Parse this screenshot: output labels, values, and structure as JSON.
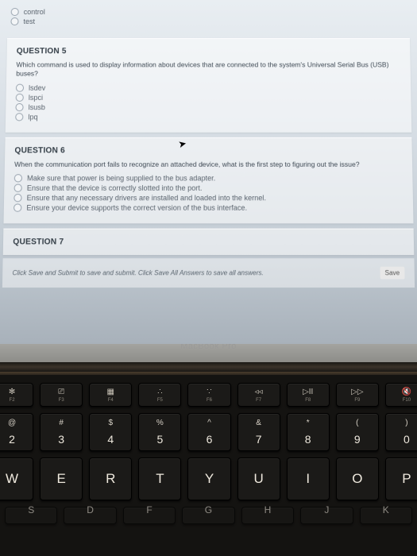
{
  "topOptions": [
    "control",
    "test"
  ],
  "q5": {
    "title": "QUESTION 5",
    "prompt": "Which command is used to display information about devices that are connected to the system's Universal Serial Bus (USB) buses?",
    "options": [
      "lsdev",
      "lspci",
      "lsusb",
      "lpq"
    ]
  },
  "q6": {
    "title": "QUESTION 6",
    "prompt": "When the communication port fails to recognize an attached device, what is the first step to figuring out the issue?",
    "options": [
      "Make sure that power is being supplied to the bus adapter.",
      "Ensure that the device is correctly slotted into the port.",
      "Ensure that any necessary drivers are installed and loaded into the kernel.",
      "Ensure your device supports the correct version of the bus interface."
    ]
  },
  "q7": {
    "title": "QUESTION 7"
  },
  "footer": {
    "text": "Click Save and Submit to save and submit. Click Save All Answers to save all answers.",
    "button": "Save"
  },
  "bezel": "MacBook Pro",
  "keyboard": {
    "frow": [
      {
        "glyph": "✻",
        "label": "F2"
      },
      {
        "glyph": "⎚",
        "label": "F3"
      },
      {
        "glyph": "▦",
        "label": "F4"
      },
      {
        "glyph": "∴",
        "label": "F5"
      },
      {
        "glyph": "∵",
        "label": "F6"
      },
      {
        "glyph": "◃◃",
        "label": "F7"
      },
      {
        "glyph": "▷II",
        "label": "F8"
      },
      {
        "glyph": "▷▷",
        "label": "F9"
      },
      {
        "glyph": "🔇",
        "label": "F10"
      }
    ],
    "numrow": [
      {
        "upper": "@",
        "lower": "2"
      },
      {
        "upper": "#",
        "lower": "3"
      },
      {
        "upper": "$",
        "lower": "4"
      },
      {
        "upper": "%",
        "lower": "5"
      },
      {
        "upper": "^",
        "lower": "6"
      },
      {
        "upper": "&",
        "lower": "7"
      },
      {
        "upper": "*",
        "lower": "8"
      },
      {
        "upper": "(",
        "lower": "9"
      },
      {
        "upper": ")",
        "lower": "0"
      }
    ],
    "alpharow": [
      "W",
      "E",
      "R",
      "T",
      "Y",
      "U",
      "I",
      "O",
      "P"
    ],
    "row4": [
      "S",
      "D",
      "F",
      "G",
      "H",
      "J",
      "K"
    ]
  }
}
